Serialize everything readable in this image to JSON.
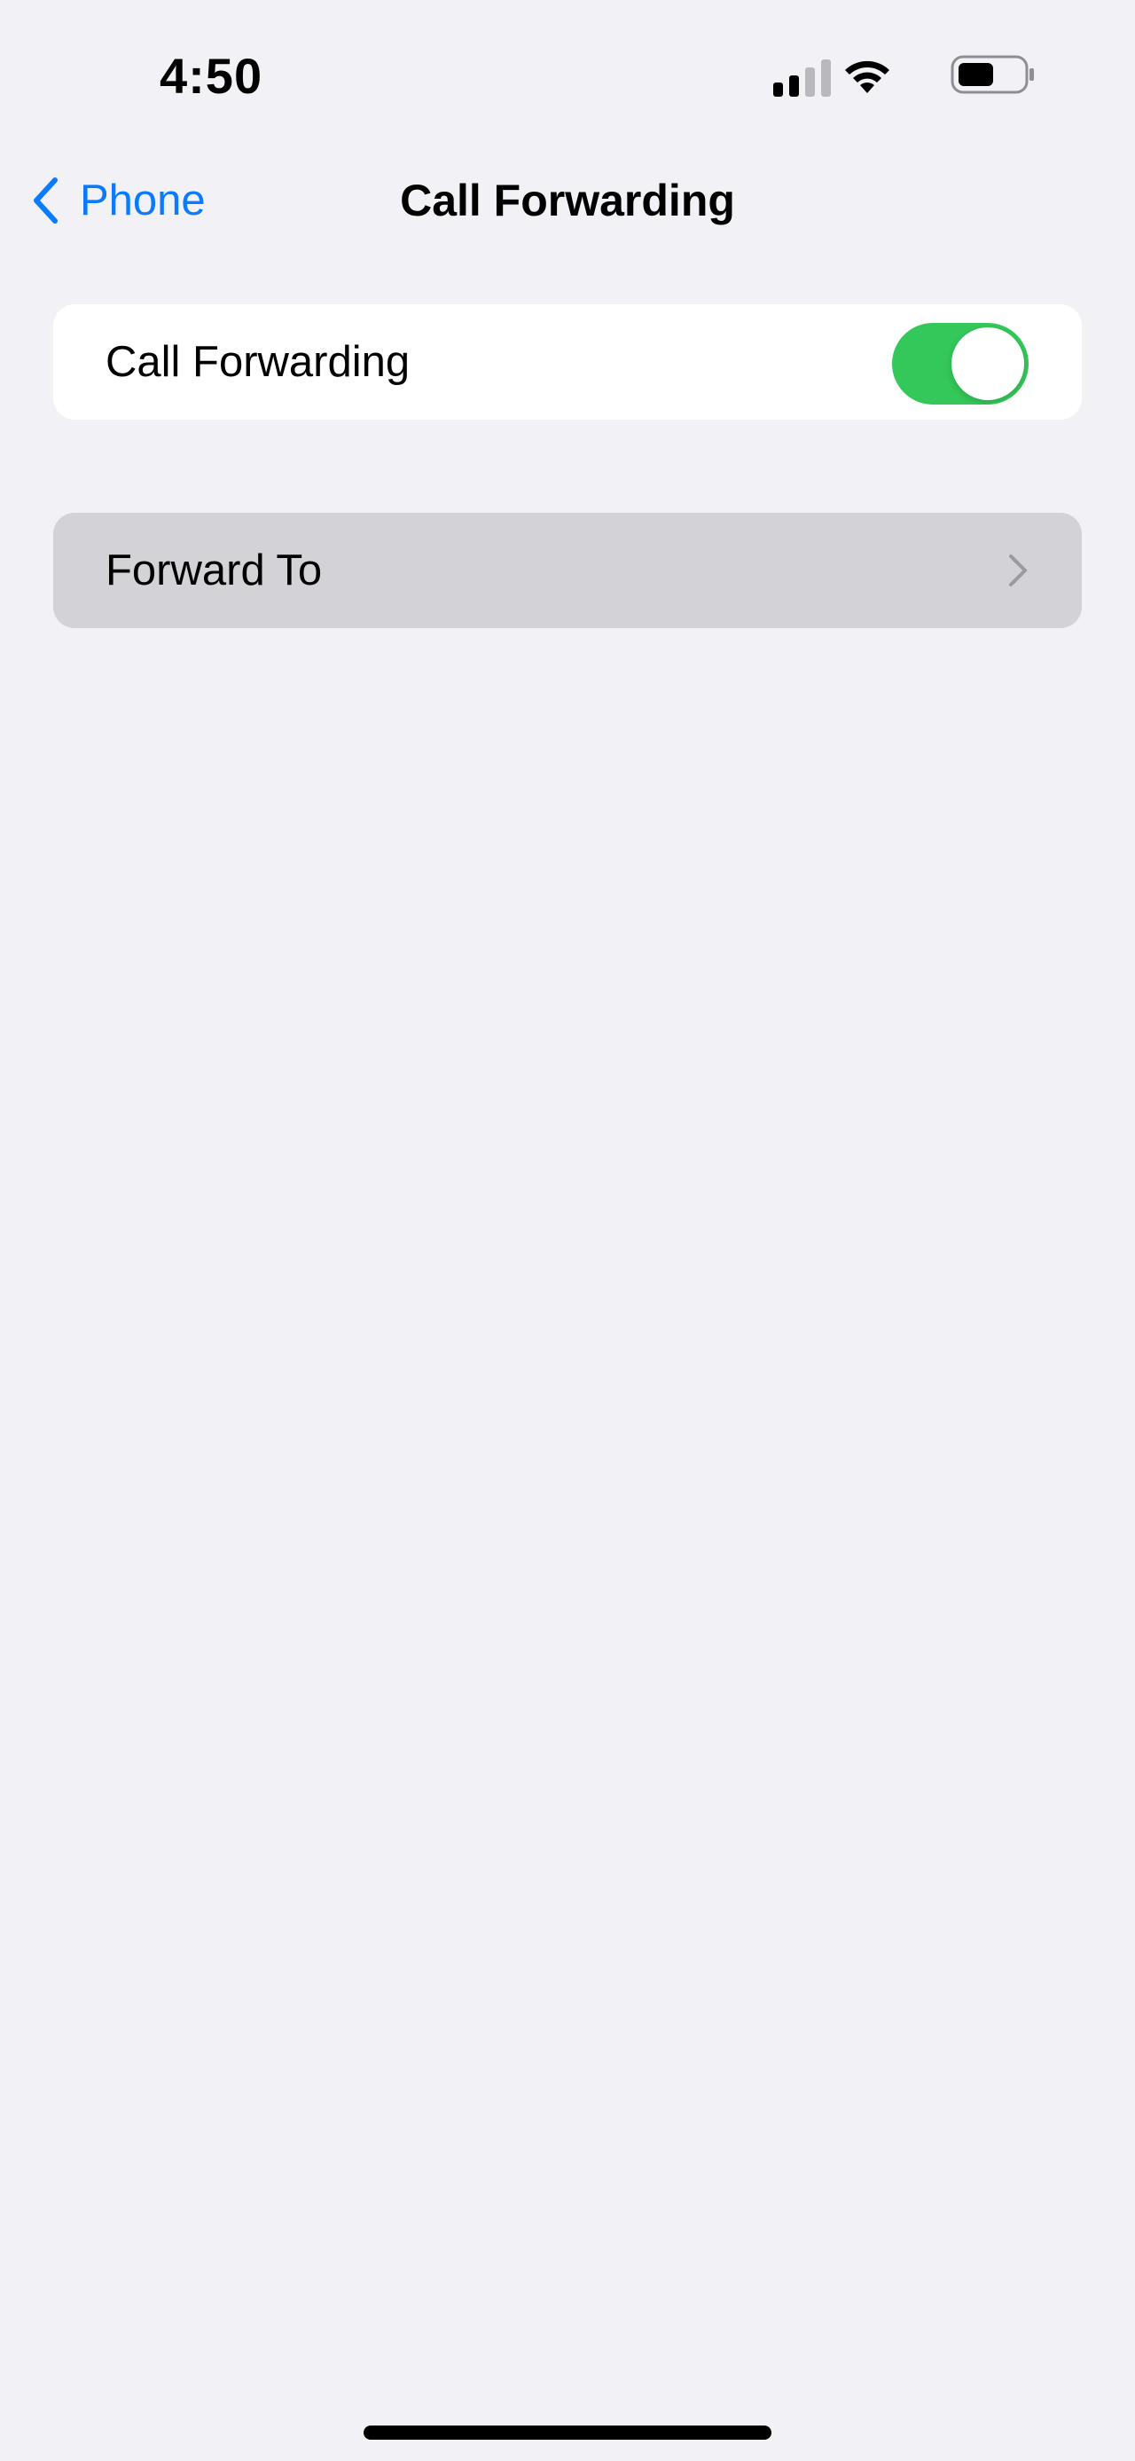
{
  "status_bar": {
    "time": "4:50",
    "icons": [
      "cellular-signal-icon",
      "wifi-icon",
      "battery-icon"
    ]
  },
  "nav": {
    "back_label": "Phone",
    "title": "Call Forwarding"
  },
  "settings": {
    "call_forwarding": {
      "label": "Call Forwarding",
      "enabled": true
    },
    "forward_to": {
      "label": "Forward To",
      "icon": "chevron-right-icon"
    }
  },
  "colors": {
    "background": "#f1f1f6",
    "accent": "#0a7aff",
    "toggle_on": "#34c759",
    "highlighted_row": "#d2d2d7"
  }
}
